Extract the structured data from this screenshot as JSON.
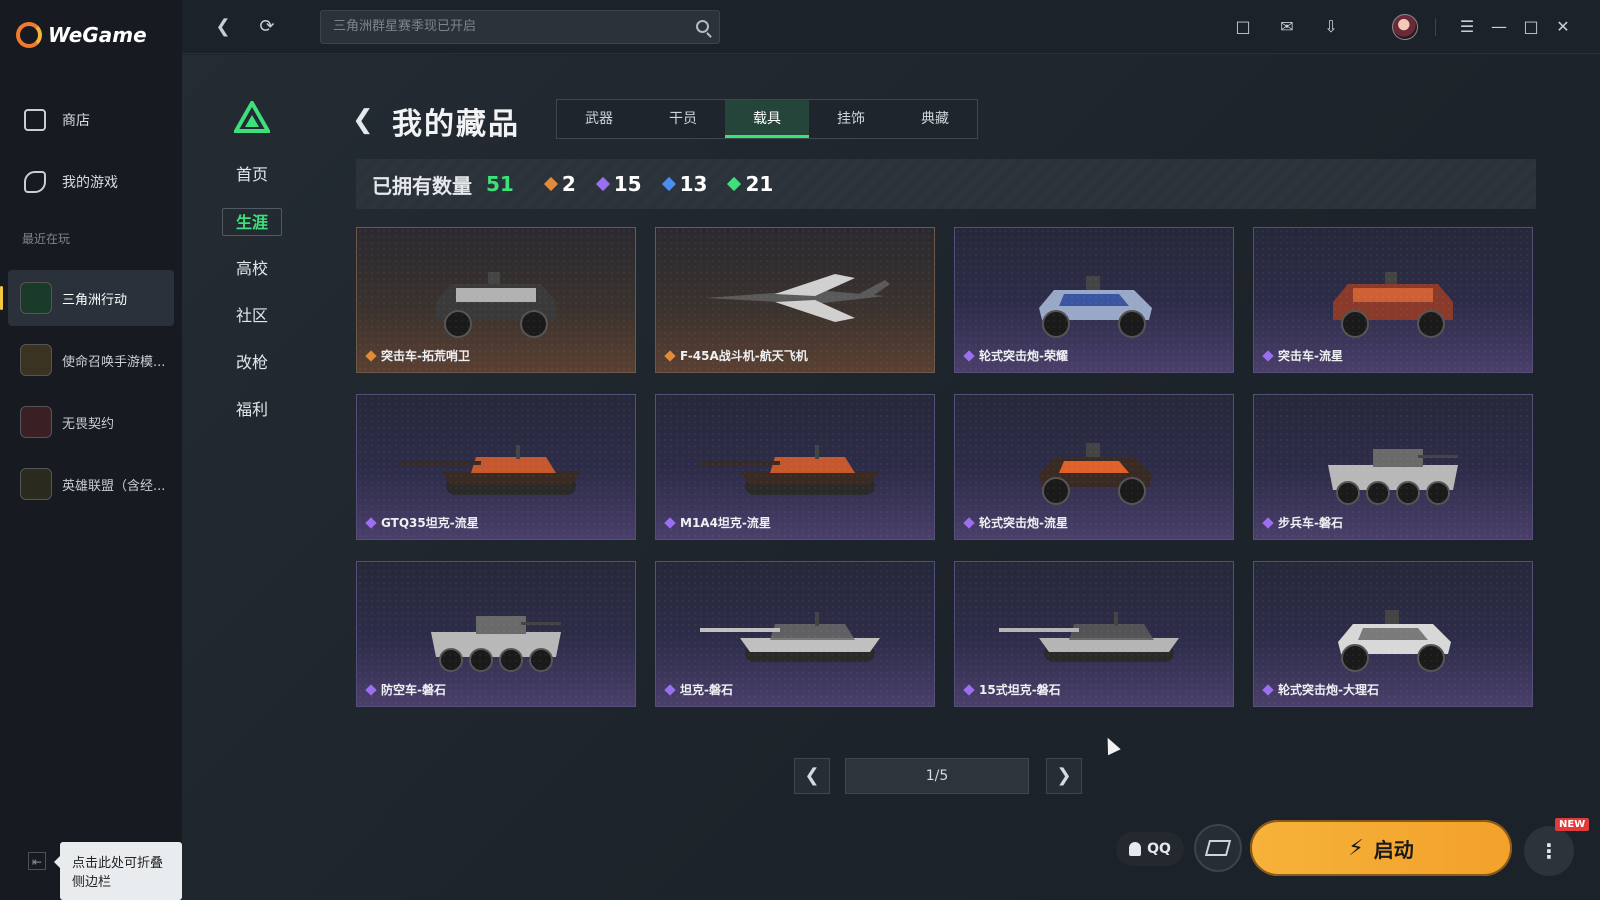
{
  "app": {
    "name": "WeGame"
  },
  "sidebar": {
    "nav": [
      {
        "label": "商店",
        "icon": "store-bag-icon"
      },
      {
        "label": "我的游戏",
        "icon": "my-games-icon"
      }
    ],
    "recent_label": "最近在玩",
    "games": [
      {
        "label": "三角洲行动",
        "icon": "delta-force-game-icon",
        "color": "#1a3a2a",
        "active": true
      },
      {
        "label": "使命召唤手游模...",
        "icon": "cod-mobile-game-icon",
        "color": "#3a3322"
      },
      {
        "label": "无畏契约",
        "icon": "valorant-game-icon",
        "color": "#3a1f25"
      },
      {
        "label": "英雄联盟（含经...",
        "icon": "league-of-legends-game-icon",
        "color": "#2a2a1f"
      }
    ],
    "collapse_tooltip": "点击此处可折叠侧边栏"
  },
  "topbar": {
    "search_placeholder": "三角洲群星赛季现已开启",
    "icons": [
      "chat-icon",
      "mail-icon",
      "download-icon",
      "avatar",
      "menu-icon",
      "minimize-icon",
      "maximize-icon",
      "close-icon"
    ]
  },
  "game_nav": {
    "items": [
      "首页",
      "生涯",
      "高校",
      "社区",
      "改枪",
      "福利"
    ],
    "active": "生涯"
  },
  "page": {
    "title": "我的藏品",
    "tabs": [
      "武器",
      "干员",
      "载具",
      "挂饰",
      "典藏"
    ],
    "active_tab": "载具"
  },
  "stats": {
    "owned_label": "已拥有数量",
    "owned_total": "51",
    "rarities": [
      {
        "count": "2",
        "color": "#e08a3a"
      },
      {
        "count": "15",
        "color": "#9b6ff0"
      },
      {
        "count": "13",
        "color": "#4a8ff0"
      },
      {
        "count": "21",
        "color": "#3de07b"
      }
    ]
  },
  "items": [
    {
      "name": "突击车-拓荒哨卫",
      "rarity": "gold",
      "vehicle": "jeep",
      "paint": "#3a3a3a",
      "accent": "#cfcfcf"
    },
    {
      "name": "F-45A战斗机-航天飞机",
      "rarity": "gold",
      "vehicle": "jet",
      "paint": "#5a5a5a",
      "accent": "#d0d0d0"
    },
    {
      "name": "轮式突击炮-荣耀",
      "rarity": "purple",
      "vehicle": "buggy",
      "paint": "#9aa8c8",
      "accent": "#3a56a0"
    },
    {
      "name": "突击车-流星",
      "rarity": "purple",
      "vehicle": "jeep",
      "paint": "#8a3a2a",
      "accent": "#e06a3a"
    },
    {
      "name": "GTQ35坦克-流星",
      "rarity": "purple",
      "vehicle": "tank",
      "paint": "#3a2a24",
      "accent": "#e0602a"
    },
    {
      "name": "M1A4坦克-流星",
      "rarity": "purple",
      "vehicle": "tank",
      "paint": "#3a2a24",
      "accent": "#e0602a"
    },
    {
      "name": "轮式突击炮-流星",
      "rarity": "purple",
      "vehicle": "buggy",
      "paint": "#3a2a24",
      "accent": "#e0602a"
    },
    {
      "name": "步兵车-磐石",
      "rarity": "purple",
      "vehicle": "apc",
      "paint": "#b8b8b8",
      "accent": "#6a6a6a"
    },
    {
      "name": "防空车-磐石",
      "rarity": "purple",
      "vehicle": "apc",
      "paint": "#b8b8b8",
      "accent": "#6a6a6a"
    },
    {
      "name": "坦克-磐石",
      "rarity": "purple",
      "vehicle": "tank",
      "paint": "#c0c0c0",
      "accent": "#6a6a6a"
    },
    {
      "name": "15式坦克-磐石",
      "rarity": "purple",
      "vehicle": "tank",
      "paint": "#b5b5b5",
      "accent": "#5a5a5a"
    },
    {
      "name": "轮式突击炮-大理石",
      "rarity": "purple",
      "vehicle": "buggy",
      "paint": "#d8d8d8",
      "accent": "#7a7a7a"
    }
  ],
  "pagination": {
    "label": "1/5",
    "current": 1,
    "total": 5
  },
  "launch": {
    "qq_label": "QQ",
    "launch_label": "启动",
    "new_badge": "NEW"
  }
}
